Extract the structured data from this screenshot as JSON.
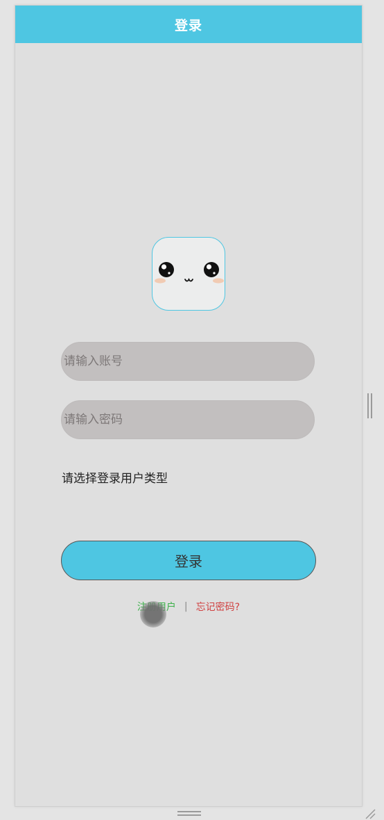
{
  "header": {
    "title": "登录",
    "background": "#4ec6e2"
  },
  "avatar": {
    "icon": "cute-face-icon"
  },
  "form": {
    "account_placeholder": "请输入账号",
    "account_value": "",
    "password_placeholder": "请输入密码",
    "password_value": "",
    "user_type_label": "请选择登录用户类型",
    "login_label": "登录"
  },
  "links": {
    "register": "注册用户",
    "separator": "|",
    "forgot": "忘记密码?",
    "register_color": "#3cb04a",
    "forgot_color": "#d04040"
  }
}
